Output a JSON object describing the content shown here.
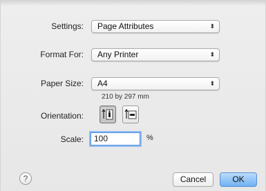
{
  "settings": {
    "label": "Settings:",
    "value": "Page Attributes"
  },
  "format_for": {
    "label": "Format For:",
    "value": "Any Printer"
  },
  "paper_size": {
    "label": "Paper Size:",
    "value": "A4",
    "dimensions": "210 by 297 mm"
  },
  "orientation": {
    "label": "Orientation:",
    "selected": "portrait"
  },
  "scale": {
    "label": "Scale:",
    "value": "100",
    "unit": "%"
  },
  "footer": {
    "help_label": "?",
    "cancel_label": "Cancel",
    "ok_label": "OK"
  },
  "colors": {
    "default_button": "#6fb1f2",
    "focus_ring": "#8fbcf0"
  }
}
